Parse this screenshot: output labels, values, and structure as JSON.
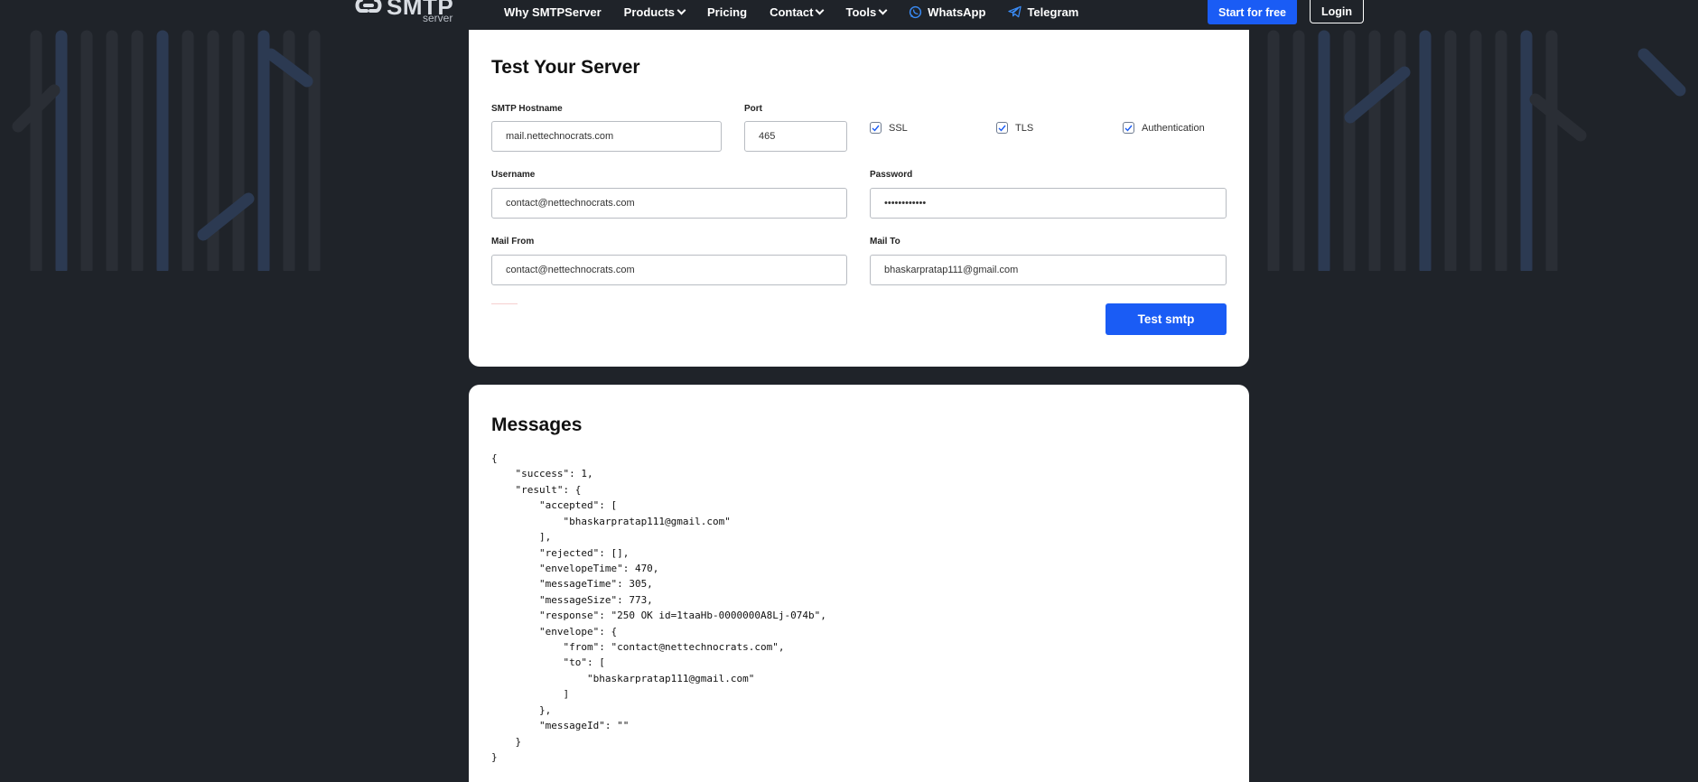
{
  "nav": {
    "logo_main": "SMTP",
    "logo_sub": "server",
    "items": [
      {
        "label": "Why SMTPServer",
        "dropdown": false
      },
      {
        "label": "Products",
        "dropdown": true
      },
      {
        "label": "Pricing",
        "dropdown": false
      },
      {
        "label": "Contact",
        "dropdown": true
      },
      {
        "label": "Tools",
        "dropdown": true
      },
      {
        "label": "WhatsApp",
        "dropdown": false,
        "icon": "whatsapp-icon"
      },
      {
        "label": "Telegram",
        "dropdown": false,
        "icon": "telegram-icon"
      }
    ],
    "start_label": "Start for free",
    "login_label": "Login"
  },
  "colors": {
    "background": "#1f2329",
    "accent": "#1a5cf5",
    "card": "#ffffff"
  },
  "form": {
    "title": "Test Your Server",
    "hostname": {
      "label": "SMTP Hostname",
      "value": "mail.nettechnocrats.com"
    },
    "port": {
      "label": "Port",
      "value": "465"
    },
    "checks": [
      {
        "label": "SSL",
        "checked": true
      },
      {
        "label": "TLS",
        "checked": true
      },
      {
        "label": "Authentication",
        "checked": true
      }
    ],
    "username": {
      "label": "Username",
      "value": "contact@nettechnocrats.com"
    },
    "password": {
      "label": "Password",
      "value": "••••••••••••"
    },
    "mail_from": {
      "label": "Mail From",
      "value": "contact@nettechnocrats.com"
    },
    "mail_to": {
      "label": "Mail To",
      "value": "bhaskarpratap111@gmail.com"
    },
    "submit_label": "Test smtp"
  },
  "messages": {
    "title": "Messages",
    "json_text": "{\n    \"success\": 1,\n    \"result\": {\n        \"accepted\": [\n            \"bhaskarpratap111@gmail.com\"\n        ],\n        \"rejected\": [],\n        \"envelopeTime\": 470,\n        \"messageTime\": 305,\n        \"messageSize\": 773,\n        \"response\": \"250 OK id=1taaHb-0000000A8Lj-074b\",\n        \"envelope\": {\n            \"from\": \"contact@nettechnocrats.com\",\n            \"to\": [\n                \"bhaskarpratap111@gmail.com\"\n            ]\n        },\n        \"messageId\": \"\"\n    }\n}"
  }
}
